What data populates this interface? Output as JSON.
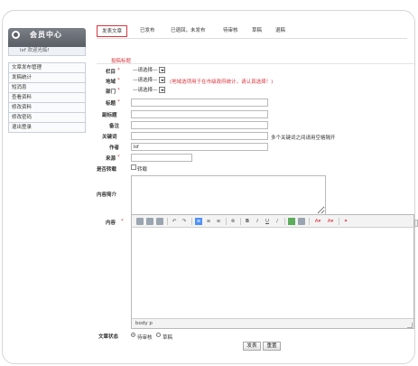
{
  "sidebar": {
    "title": "会员中心",
    "welcome": "lxf 欢迎光临!",
    "items": [
      {
        "label": "文章发布管理"
      },
      {
        "label": "发稿统计"
      },
      {
        "label": "短消息"
      },
      {
        "label": "查看资料"
      },
      {
        "label": "修改资料"
      },
      {
        "label": "修改密码"
      },
      {
        "label": "退出登录"
      }
    ]
  },
  "tabs": [
    {
      "label": "发表文章",
      "active": true
    },
    {
      "label": "已发布"
    },
    {
      "label": "已退回，未发布"
    },
    {
      "label": "待审核"
    },
    {
      "label": "草稿"
    },
    {
      "label": "退稿"
    }
  ],
  "form": {
    "section_title": "投稿标题",
    "column": {
      "label": "栏目",
      "required": "*",
      "value": "—请选择—"
    },
    "region": {
      "label": "地域",
      "required": "*",
      "value": "—请选择—",
      "hint": "(地域选项用于在市级政府统计，请认真选择！)"
    },
    "department": {
      "label": "部门",
      "required": "*",
      "value": "—请选择—"
    },
    "title": {
      "label": "标题",
      "required": "*",
      "value": ""
    },
    "subtitle": {
      "label": "副标题",
      "value": ""
    },
    "note": {
      "label": "备注",
      "value": ""
    },
    "keywords": {
      "label": "关键词",
      "value": "",
      "hint": "多个关键词之间请用空格隔开"
    },
    "author": {
      "label": "作者",
      "value": "lxf"
    },
    "source": {
      "label": "来源",
      "required": "*",
      "value": ""
    },
    "repost": {
      "label": "是否转载",
      "option": "转载"
    },
    "summary": {
      "label": "内容简介"
    },
    "content": {
      "label": "内容",
      "required": "*"
    },
    "editor_statusbar": "body p",
    "status": {
      "label": "文章状态",
      "options": [
        "待审核",
        "草稿"
      ],
      "selected": 0
    },
    "buttons": {
      "submit": "发表",
      "reset": "重置"
    }
  }
}
